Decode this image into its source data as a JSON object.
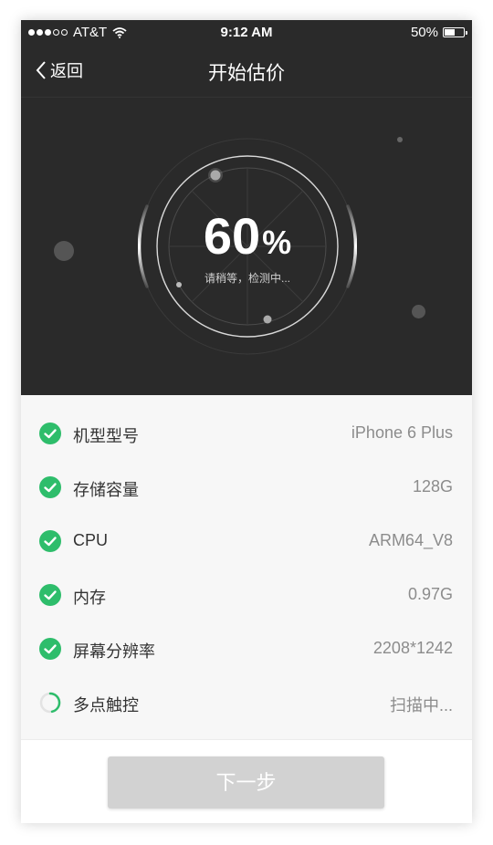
{
  "status_bar": {
    "carrier": "AT&T",
    "time": "9:12 AM",
    "battery_percent": "50%",
    "battery_level": 0.5
  },
  "nav": {
    "back_label": "返回",
    "title": "开始估价"
  },
  "progress": {
    "value": "60",
    "sign": "%",
    "status_text": "请稍等，检测中..."
  },
  "items": [
    {
      "label": "机型型号",
      "value": "iPhone 6 Plus",
      "status": "done"
    },
    {
      "label": "存储容量",
      "value": "128G",
      "status": "done"
    },
    {
      "label": "CPU",
      "value": "ARM64_V8",
      "status": "done"
    },
    {
      "label": "内存",
      "value": "0.97G",
      "status": "done"
    },
    {
      "label": "屏幕分辨率",
      "value": "2208*1242",
      "status": "done"
    },
    {
      "label": "多点触控",
      "value": "扫描中...",
      "status": "scanning"
    }
  ],
  "footer": {
    "next_label": "下一步"
  },
  "colors": {
    "accent_green": "#2ebd6b",
    "dark_bg": "#2a2a2a",
    "button_disabled": "#d2d2d2"
  }
}
